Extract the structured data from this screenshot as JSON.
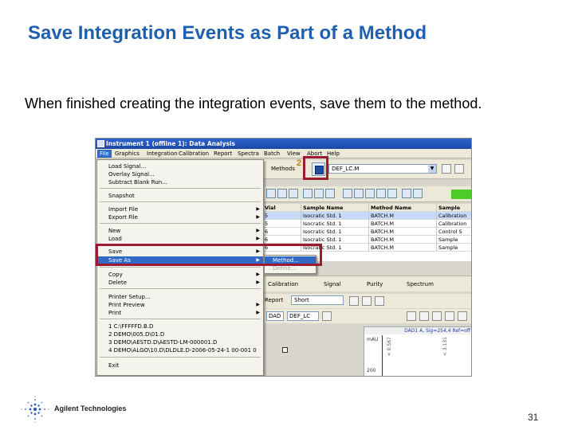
{
  "slide": {
    "title": "Save Integration Events as Part of a Method",
    "subtitle": "When finished creating the integration events, save them to the method.",
    "page_number": "31",
    "logo_text": "Agilent Technologies",
    "accent_color": "#1f5fb0",
    "callout_color": "#9b1b30"
  },
  "app": {
    "window_title": "Instrument 1 (offline 1): Data Analysis",
    "menubar": [
      "File",
      "Graphics",
      "Integration",
      "Calibration",
      "Report",
      "Spectra",
      "Batch",
      "View",
      "Abort",
      "Help"
    ],
    "callout_number": "2",
    "methods_label": "Methods",
    "method_value": "DEF_LC.M"
  },
  "file_menu": {
    "items": [
      {
        "label": "Load Signal...",
        "has_sub": false
      },
      {
        "label": "Overlay Signal...",
        "has_sub": false
      },
      {
        "label": "Subtract Blank Run...",
        "has_sub": false
      },
      {
        "label": "Snapshot",
        "has_sub": false
      },
      {
        "label": "Import File",
        "has_sub": true
      },
      {
        "label": "Export File",
        "has_sub": true
      },
      {
        "label": "New",
        "has_sub": true
      },
      {
        "label": "Load",
        "has_sub": true
      },
      {
        "label": "Save",
        "has_sub": true
      },
      {
        "label": "Save As",
        "has_sub": true
      },
      {
        "label": "Copy",
        "has_sub": true
      },
      {
        "label": "Delete",
        "has_sub": true
      },
      {
        "label": "Printer Setup...",
        "has_sub": false
      },
      {
        "label": "Print Preview",
        "has_sub": true
      },
      {
        "label": "Print",
        "has_sub": true
      },
      {
        "label": "1 C:\\FFFFFD.B.D",
        "has_sub": false
      },
      {
        "label": "2 DEMO\\005.D\\01.D",
        "has_sub": false
      },
      {
        "label": "3 DEMO\\AESTD.D\\AESTD-LM-000001.D",
        "has_sub": false
      },
      {
        "label": "4 DEMO\\ALGO\\10.D\\DLDLE.D-2006-05-24-1 00-001 0",
        "has_sub": false
      },
      {
        "label": "Exit",
        "has_sub": false
      }
    ],
    "submenu": [
      "Method...",
      "Define..."
    ]
  },
  "grid": {
    "headers": [
      "Vial",
      "Sample Name",
      "Method Name",
      "Sample"
    ],
    "rows": [
      [
        "5",
        "Isocratic Std. 1",
        "BATCH.M",
        "Calibration"
      ],
      [
        "5",
        "Isocratic Std. 1",
        "BATCH.M",
        "Calibration"
      ],
      [
        "6",
        "Isocratic Std. 1",
        "BATCH.M",
        "Control S"
      ],
      [
        "6",
        "Isocratic Std. 1",
        "BATCH.M",
        "Sample"
      ],
      [
        "6",
        "Isocratic Std. 1",
        "BATCH.M",
        "Sample"
      ]
    ]
  },
  "panel_tabs": [
    "Calibration",
    "Signal",
    "Purity",
    "Spectrum"
  ],
  "report": {
    "label": "Report",
    "value": "Short"
  },
  "row3": {
    "combo1": "DAD",
    "combo2": "DEF_LC"
  },
  "chart": {
    "header": "DAD1 A, Sig=254,4 Ref=off",
    "ylabel": "mAU",
    "ytick": "200",
    "peaks": [
      "< 0.567",
      "< 3.131"
    ]
  }
}
